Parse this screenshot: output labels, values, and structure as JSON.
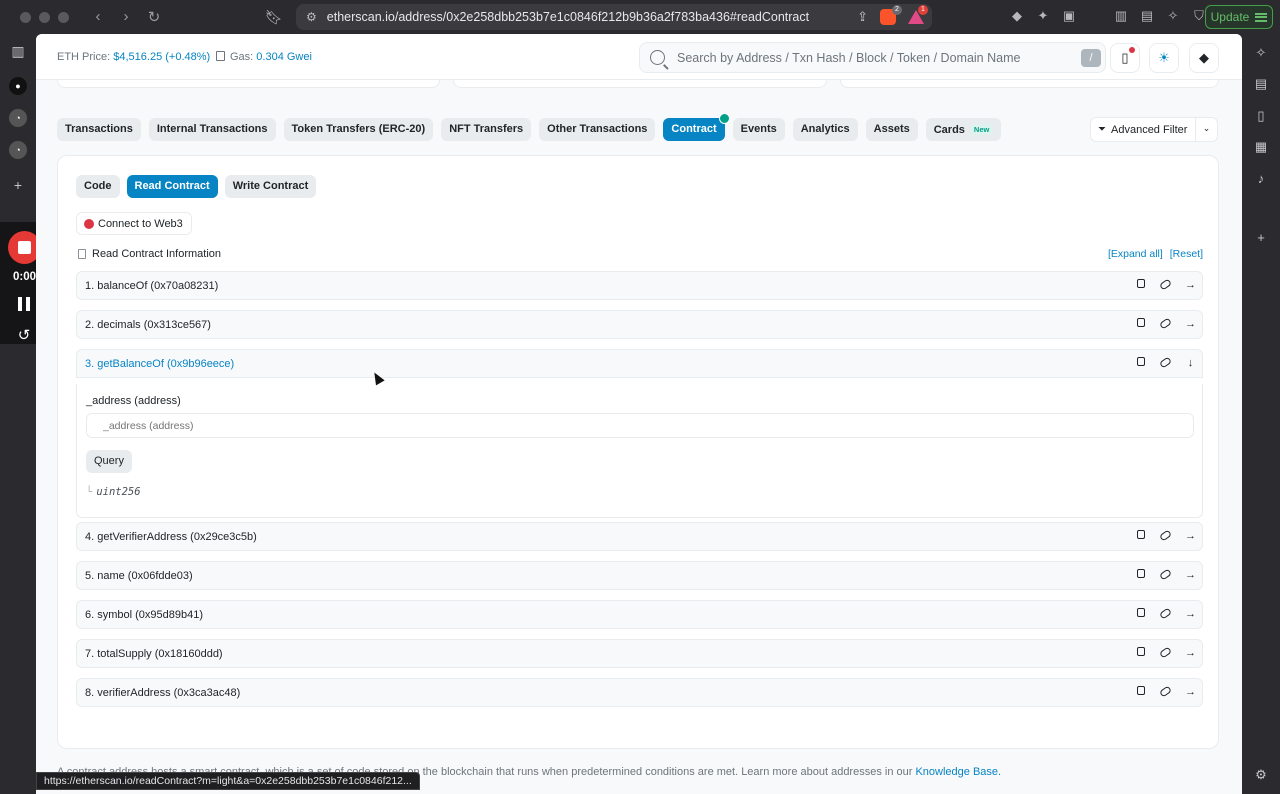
{
  "browser": {
    "url": "etherscan.io/address/0x2e258dbb253b7e1c0846f212b9b36a2f783ba436#readContract",
    "brave_badge": "2",
    "rewards_badge": "1",
    "update_label": "Update"
  },
  "recorder": {
    "time": "0:00"
  },
  "topbar": {
    "eth_label": "ETH Price:",
    "eth_value": "$4,516.25 (+0.48%)",
    "gas_label": "Gas:",
    "gas_value": "0.304 Gwei",
    "search_placeholder": "Search by Address / Txn Hash / Block / Token / Domain Name",
    "search_shortcut": "/"
  },
  "tabs": [
    "Transactions",
    "Internal Transactions",
    "Token Transfers (ERC-20)",
    "NFT Transfers",
    "Other Transactions",
    "Contract",
    "Events",
    "Analytics",
    "Assets",
    "Cards"
  ],
  "tabs_badge": "New",
  "advanced_filter": "Advanced Filter",
  "contract": {
    "subtabs": [
      "Code",
      "Read Contract",
      "Write Contract"
    ],
    "connect": "Connect to Web3",
    "read_info": "Read Contract Information",
    "expand_all": "[Expand all]",
    "reset": "[Reset]",
    "functions": [
      "1. balanceOf (0x70a08231)",
      "2. decimals (0x313ce567)",
      "3. getBalanceOf (0x9b96eece)",
      "4. getVerifierAddress (0x29ce3c5b)",
      "5. name (0x06fdde03)",
      "6. symbol (0x95d89b41)",
      "7. totalSupply (0x18160ddd)",
      "8. verifierAddress (0x3ca3ac48)"
    ],
    "expanded": {
      "param_label": "_address (address)",
      "param_placeholder": "_address (address)",
      "query": "Query",
      "return_type": "uint256"
    }
  },
  "footer": {
    "text": "A contract address hosts a smart contract, which is a set of code stored on the blockchain that runs when predetermined conditions are met. Learn more about addresses in our ",
    "link": "Knowledge Base."
  },
  "status_url": "https://etherscan.io/readContract?m=light&a=0x2e258dbb253b7e1c0846f212...",
  "colors": {
    "accent": "#0784c3",
    "success": "#00a186",
    "danger": "#dc3545"
  }
}
